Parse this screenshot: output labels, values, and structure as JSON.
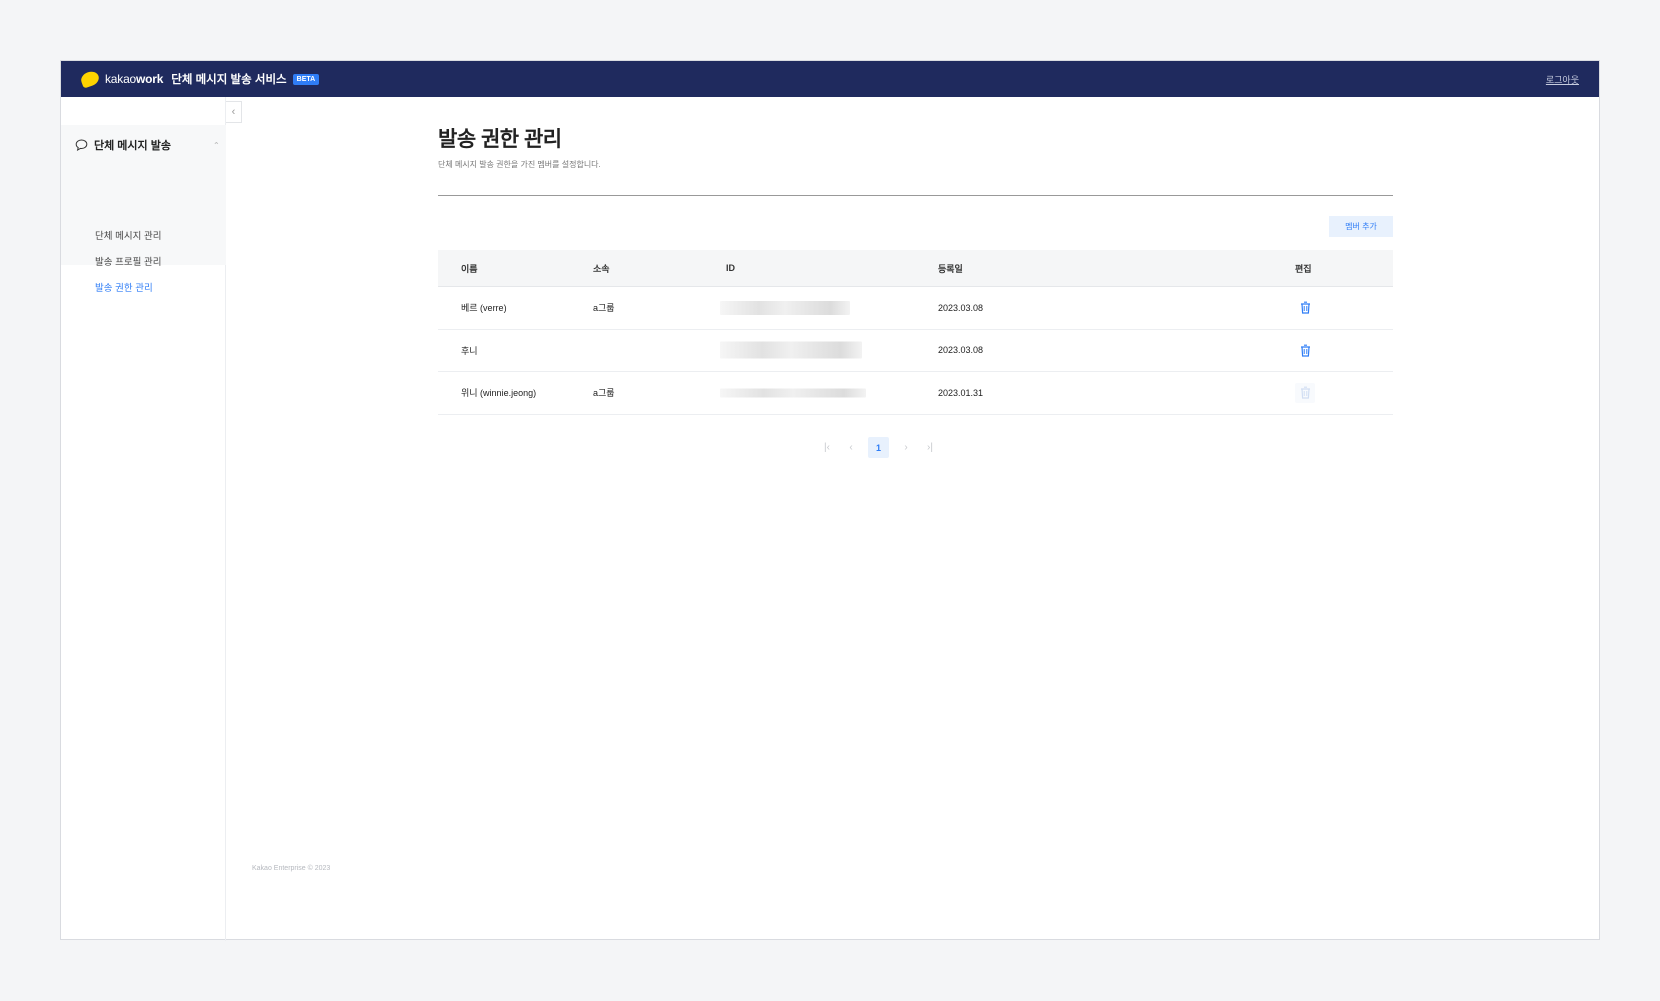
{
  "header": {
    "brand_prefix": "kakao",
    "brand_suffix": "work",
    "service_title": "단체 메시지 발송 서비스",
    "beta_badge": "BETA",
    "logout_label": "로그아웃"
  },
  "sidebar": {
    "group_label": "단체 메시지 발송",
    "items": [
      {
        "label": "단체 메시지 관리",
        "active": false
      },
      {
        "label": "발송 프로필 관리",
        "active": false
      },
      {
        "label": "발송 권한 관리",
        "active": true
      }
    ]
  },
  "main": {
    "title": "발송 권한 관리",
    "description": "단체 메시지 발송 권한을 가진 멤버를 설정합니다.",
    "add_member_label": "멤버 추가",
    "table": {
      "columns": [
        "이름",
        "소속",
        "ID",
        "등록일",
        "편집"
      ],
      "rows": [
        {
          "name": "베르 (verre)",
          "org": "a그룹",
          "id": "",
          "date": "2023.03.08",
          "deletable": true
        },
        {
          "name": "후니",
          "org": "",
          "id": "",
          "date": "2023.03.08",
          "deletable": true
        },
        {
          "name": "위니 (winnie.jeong)",
          "org": "a그룹",
          "id": "",
          "date": "2023.01.31",
          "deletable": false
        }
      ]
    },
    "pagination": {
      "current_page": "1"
    }
  },
  "footer": {
    "copyright": "Kakao Enterprise © 2023"
  },
  "colors": {
    "topbar": "#1f2a5e",
    "accent": "#2f7df6",
    "logo": "#ffd400"
  },
  "icons": [
    "chat-bubble-icon",
    "chevron-left-icon",
    "trash-icon",
    "first-page-icon",
    "prev-page-icon",
    "next-page-icon",
    "last-page-icon"
  ]
}
